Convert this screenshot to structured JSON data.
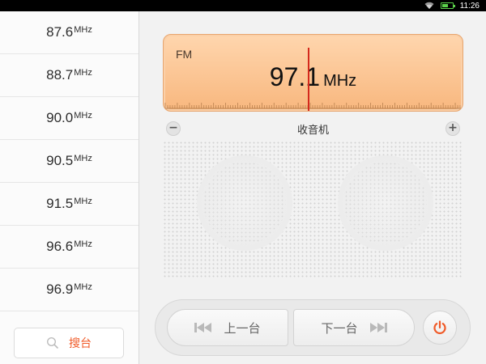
{
  "status_bar": {
    "time": "11:26"
  },
  "sidebar": {
    "stations": [
      {
        "freq": "87.6",
        "unit": "MHz"
      },
      {
        "freq": "88.7",
        "unit": "MHz"
      },
      {
        "freq": "90.0",
        "unit": "MHz"
      },
      {
        "freq": "90.5",
        "unit": "MHz"
      },
      {
        "freq": "91.5",
        "unit": "MHz"
      },
      {
        "freq": "96.6",
        "unit": "MHz"
      },
      {
        "freq": "96.9",
        "unit": "MHz"
      }
    ],
    "scan_label": "搜台"
  },
  "tuner": {
    "band": "FM",
    "frequency": "97.1",
    "unit": "MHz",
    "title": "收音机",
    "volume_down": "−",
    "volume_up": "+"
  },
  "controls": {
    "prev_label": "上一台",
    "next_label": "下一台"
  },
  "colors": {
    "accent": "#f05a28",
    "display_bg": "#fbc493",
    "needle": "#d4291d"
  },
  "icons": [
    "wifi-icon",
    "battery-icon",
    "search-icon",
    "skip-previous-icon",
    "skip-next-icon",
    "power-icon"
  ]
}
